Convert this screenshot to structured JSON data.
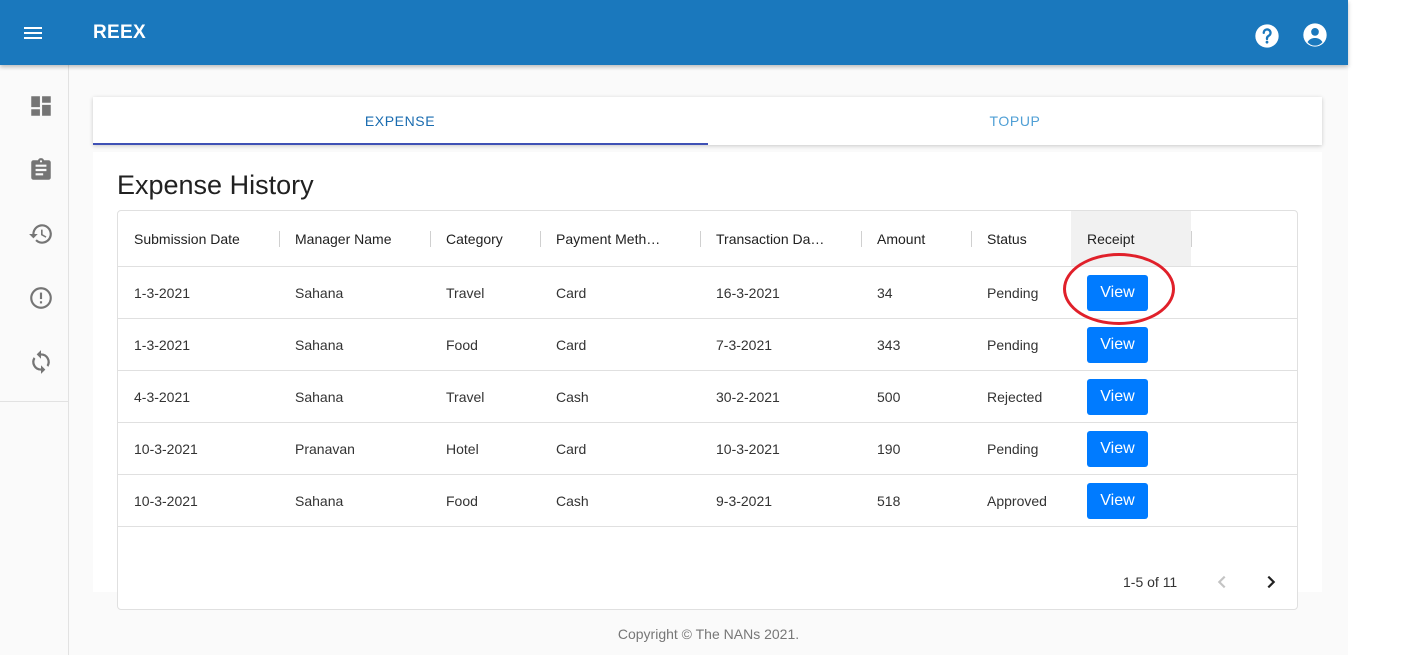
{
  "app": {
    "title": "REEX"
  },
  "colors": {
    "topbar": "#1a78bd",
    "accent": "#3f51b5",
    "button": "#007bff",
    "annotation": "#e0202a"
  },
  "header": {
    "icons": [
      "menu-icon",
      "help-icon",
      "account-circle-icon"
    ]
  },
  "sidebar": {
    "items": [
      {
        "icon": "dashboard-icon"
      },
      {
        "icon": "assignment-icon"
      },
      {
        "icon": "history-icon"
      },
      {
        "icon": "error-outline-icon"
      },
      {
        "icon": "sync-icon"
      }
    ]
  },
  "tabs": [
    {
      "label": "EXPENSE",
      "active": true
    },
    {
      "label": "TOPUP",
      "active": false
    }
  ],
  "main": {
    "title": "Expense History"
  },
  "table": {
    "columns": [
      "Submission Date",
      "Manager Name",
      "Category",
      "Payment Meth…",
      "Transaction Da…",
      "Amount",
      "Status",
      "Receipt"
    ],
    "rows": [
      {
        "submission_date": "1-3-2021",
        "manager": "Sahana",
        "category": "Travel",
        "payment": "Card",
        "transaction_date": "16-3-2021",
        "amount": "34",
        "status": "Pending",
        "receipt": "View"
      },
      {
        "submission_date": "1-3-2021",
        "manager": "Sahana",
        "category": "Food",
        "payment": "Card",
        "transaction_date": "7-3-2021",
        "amount": "343",
        "status": "Pending",
        "receipt": "View"
      },
      {
        "submission_date": "4-3-2021",
        "manager": "Sahana",
        "category": "Travel",
        "payment": "Cash",
        "transaction_date": "30-2-2021",
        "amount": "500",
        "status": "Rejected",
        "receipt": "View"
      },
      {
        "submission_date": "10-3-2021",
        "manager": "Pranavan",
        "category": "Hotel",
        "payment": "Card",
        "transaction_date": "10-3-2021",
        "amount": "190",
        "status": "Pending",
        "receipt": "View"
      },
      {
        "submission_date": "10-3-2021",
        "manager": "Sahana",
        "category": "Food",
        "payment": "Cash",
        "transaction_date": "9-3-2021",
        "amount": "518",
        "status": "Approved",
        "receipt": "View"
      }
    ]
  },
  "pagination": {
    "range": "1-5 of 11"
  },
  "footer": {
    "text": "Copyright © The NANs 2021."
  }
}
